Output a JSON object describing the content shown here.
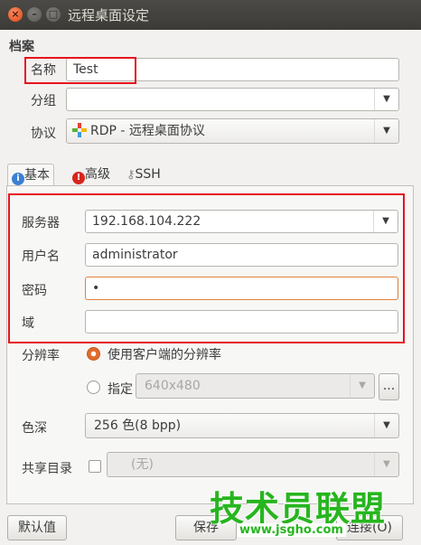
{
  "window": {
    "title": "远程桌面设定",
    "close_glyph": "×",
    "min_glyph": "–",
    "max_glyph": "□"
  },
  "section_title": "档案",
  "form": {
    "name": {
      "label": "名称",
      "value": "Test"
    },
    "group": {
      "label": "分组",
      "value": ""
    },
    "protocol": {
      "label": "协议",
      "value": "RDP - 远程桌面协议",
      "icon": "rdp-protocol-icon"
    }
  },
  "tabs": [
    {
      "label": "基本",
      "icon": "info-icon"
    },
    {
      "label": "高级",
      "icon": "warning-icon"
    },
    {
      "label": "SSH",
      "icon": "key-icon"
    }
  ],
  "basic": {
    "server": {
      "label": "服务器",
      "value": "192.168.104.222"
    },
    "username": {
      "label": "用户名",
      "value": "administrator"
    },
    "password": {
      "label": "密码",
      "value": "•"
    },
    "domain": {
      "label": "域",
      "value": ""
    },
    "resolution": {
      "label": "分辨率",
      "option_client": "使用客户端的分辨率",
      "option_custom": "指定",
      "custom_value": "640x480",
      "more_button": "..."
    },
    "color_depth": {
      "label": "色深",
      "value": "256 色(8 bpp)"
    },
    "share_folder": {
      "label": "共享目录",
      "value": "(无)"
    }
  },
  "buttons": {
    "default": "默认值",
    "save": "保存",
    "connect": "连接(O)"
  },
  "watermark": {
    "text": "技术员联盟",
    "url": "www.jsgho.com"
  },
  "colors": {
    "highlight": "#e6141e",
    "accent": "#e06b2c",
    "watermark": "#27b51f"
  }
}
